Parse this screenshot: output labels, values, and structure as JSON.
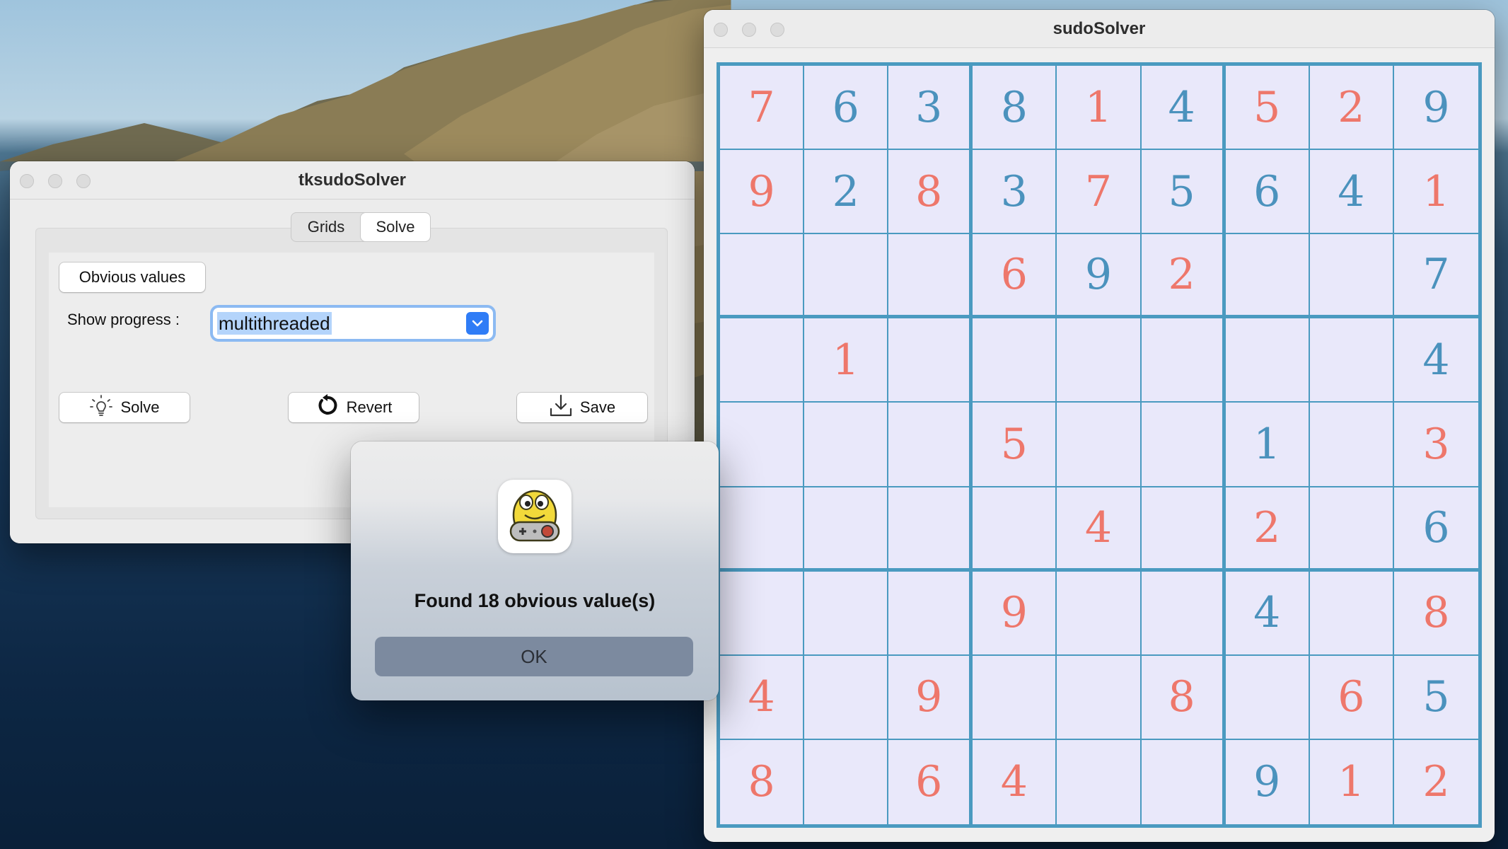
{
  "tk_window": {
    "title": "tksudoSolver",
    "tabs": [
      {
        "label": "Grids",
        "active": false
      },
      {
        "label": "Solve",
        "active": true
      }
    ],
    "obvious_button": "Obvious values",
    "progress_label": "Show progress :",
    "progress_value": "multithreaded",
    "solve_button": "Solve",
    "revert_button": "Revert",
    "save_button": "Save"
  },
  "sudo_window": {
    "title": "sudoSolver",
    "colors": {
      "coral": "#ee776b",
      "teal": "#4b92bd",
      "grid_line": "#4a9ac0",
      "cell_bg": "#e9e8fa"
    },
    "grid": [
      [
        "7",
        "6",
        "3",
        "8",
        "1",
        "4",
        "5",
        "2",
        "9"
      ],
      [
        "9",
        "2",
        "8",
        "3",
        "7",
        "5",
        "6",
        "4",
        "1"
      ],
      [
        "",
        "",
        "",
        "6",
        "9",
        "2",
        "",
        "",
        "7"
      ],
      [
        "",
        "1",
        "",
        "",
        "",
        "",
        "",
        "",
        "4"
      ],
      [
        "",
        "",
        "",
        "5",
        "",
        "",
        "1",
        "",
        "3"
      ],
      [
        "",
        "",
        "",
        "",
        "4",
        "",
        "2",
        "",
        "6"
      ],
      [
        "",
        "",
        "",
        "9",
        "",
        "",
        "4",
        "",
        "8"
      ],
      [
        "4",
        "",
        "9",
        "",
        "",
        "8",
        "",
        "6",
        "5"
      ],
      [
        "8",
        "",
        "6",
        "4",
        "",
        "",
        "9",
        "1",
        "2"
      ]
    ],
    "colors_grid": [
      [
        "c",
        "t",
        "t",
        "t",
        "c",
        "t",
        "c",
        "c",
        "t"
      ],
      [
        "c",
        "t",
        "c",
        "t",
        "c",
        "t",
        "t",
        "t",
        "c"
      ],
      [
        "",
        "",
        "",
        "c",
        "t",
        "c",
        "",
        "",
        "t"
      ],
      [
        "",
        "c",
        "",
        "",
        "",
        "",
        "",
        "",
        "t"
      ],
      [
        "",
        "",
        "",
        "c",
        "",
        "",
        "t",
        "",
        "c"
      ],
      [
        "",
        "",
        "",
        "",
        "c",
        "",
        "c",
        "",
        "t"
      ],
      [
        "",
        "",
        "",
        "c",
        "",
        "",
        "t",
        "",
        "c"
      ],
      [
        "c",
        "",
        "c",
        "",
        "",
        "c",
        "",
        "c",
        "t"
      ],
      [
        "c",
        "",
        "c",
        "c",
        "",
        "",
        "t",
        "c",
        "c"
      ]
    ]
  },
  "dialog": {
    "message": "Found 18 obvious value(s)",
    "ok_button": "OK"
  }
}
